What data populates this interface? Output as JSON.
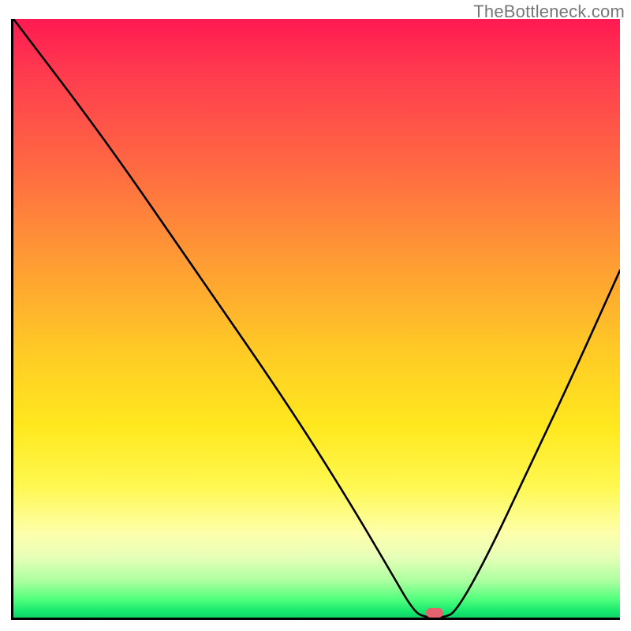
{
  "watermark": "TheBottleneck.com",
  "chart_data": {
    "type": "line",
    "title": "",
    "xlabel": "",
    "ylabel": "",
    "xlim": [
      0,
      100
    ],
    "ylim": [
      0,
      100
    ],
    "grid": false,
    "legend": false,
    "series": [
      {
        "name": "bottleneck-curve",
        "x": [
          0,
          15,
          30,
          45,
          55,
          62,
          66,
          68,
          71,
          73,
          78,
          85,
          92,
          100
        ],
        "values": [
          100,
          80,
          58,
          36,
          20,
          8,
          1,
          0,
          0,
          1,
          10,
          25,
          40,
          58
        ]
      }
    ],
    "annotations": [
      {
        "name": "optimal-marker",
        "x": 69.5,
        "y": 0.8,
        "shape": "pill",
        "color": "#e4636f"
      }
    ],
    "background_gradient": {
      "direction": "top-to-bottom",
      "stops": [
        {
          "pct": 0,
          "color": "#ff1a52"
        },
        {
          "pct": 55,
          "color": "#ffc926"
        },
        {
          "pct": 78,
          "color": "#fff850"
        },
        {
          "pct": 100,
          "color": "#0fd468"
        }
      ]
    }
  }
}
